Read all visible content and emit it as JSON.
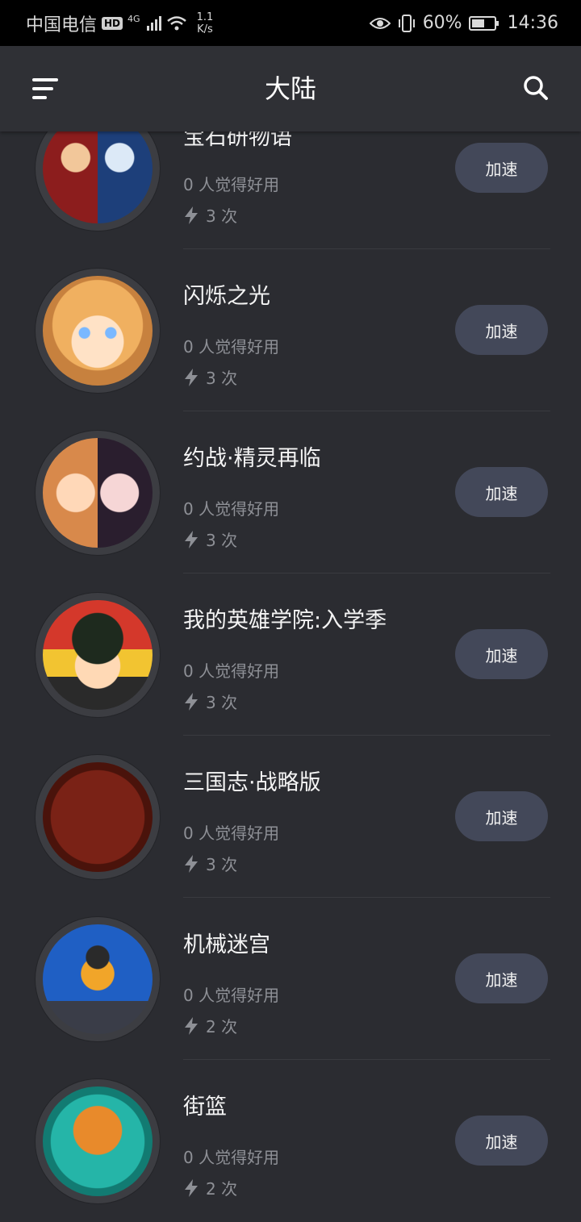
{
  "status_bar": {
    "carrier": "中国电信",
    "hd": "HD",
    "network": "4G",
    "speed_top": "1.1",
    "speed_bottom": "K/s",
    "battery": "60%",
    "battery_level": 0.6,
    "time": "14:36"
  },
  "header": {
    "title": "大陆",
    "menu_icon": "menu-icon",
    "search_icon": "search-icon"
  },
  "colors": {
    "background": "#2b2c31",
    "accent_button": "#434859",
    "secondary_text": "#8e9096"
  },
  "games": [
    {
      "name": "宝石研物语",
      "rating": "0 人觉得好用",
      "count": "3 次",
      "button": "加速"
    },
    {
      "name": "闪烁之光",
      "rating": "0 人觉得好用",
      "count": "3 次",
      "button": "加速"
    },
    {
      "name": "约战·精灵再临",
      "rating": "0 人觉得好用",
      "count": "3 次",
      "button": "加速"
    },
    {
      "name": "我的英雄学院:入学季",
      "rating": "0 人觉得好用",
      "count": "3 次",
      "button": "加速"
    },
    {
      "name": "三国志·战略版",
      "rating": "0 人觉得好用",
      "count": "3 次",
      "button": "加速"
    },
    {
      "name": "机械迷宫",
      "rating": "0 人觉得好用",
      "count": "2 次",
      "button": "加速"
    },
    {
      "name": "街篮",
      "rating": "0 人觉得好用",
      "count": "2 次",
      "button": "加速"
    }
  ]
}
